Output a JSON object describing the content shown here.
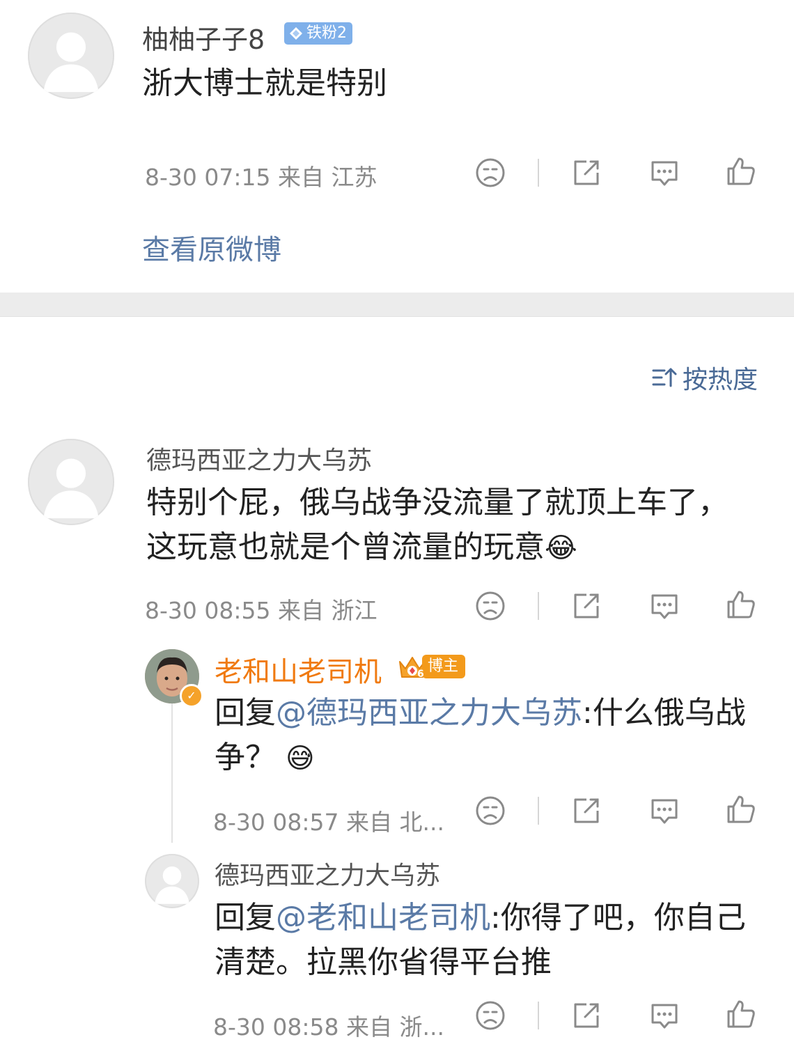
{
  "post": {
    "username": "柚柚子子8",
    "fan_badge": "铁粉2",
    "content": "浙大博士就是特别",
    "meta": "8-30 07:15  来自 江苏",
    "view_original": "查看原微博"
  },
  "sort": {
    "label": "按热度"
  },
  "comments": [
    {
      "username": "德玛西亚之力大乌苏",
      "content": "特别个屁，俄乌战争没流量了就顶上车了，这玩意也就是个曾流量的玩意",
      "emoji": "😂",
      "meta": "8-30 08:55  来自 浙江"
    }
  ],
  "replies": [
    {
      "username": "老和山老司机",
      "badge": "博主",
      "badge_level": "6",
      "prefix": "回复",
      "mention": "@德玛西亚之力大乌苏",
      "content": ":什么俄乌战争？",
      "emoji": "😅",
      "meta": "8-30 08:57  来自 北..."
    },
    {
      "username": "德玛西亚之力大乌苏",
      "prefix": "回复",
      "mention": "@老和山老司机",
      "content": ":你得了吧，你自己清楚。拉黑你省得平台推",
      "meta": "8-30 08:58  来自 浙..."
    }
  ],
  "colors": {
    "link": "#5a7aa6",
    "host_name": "#f07a10",
    "badge_fan": "#7fb0ea",
    "badge_host": "#f39a1b"
  }
}
